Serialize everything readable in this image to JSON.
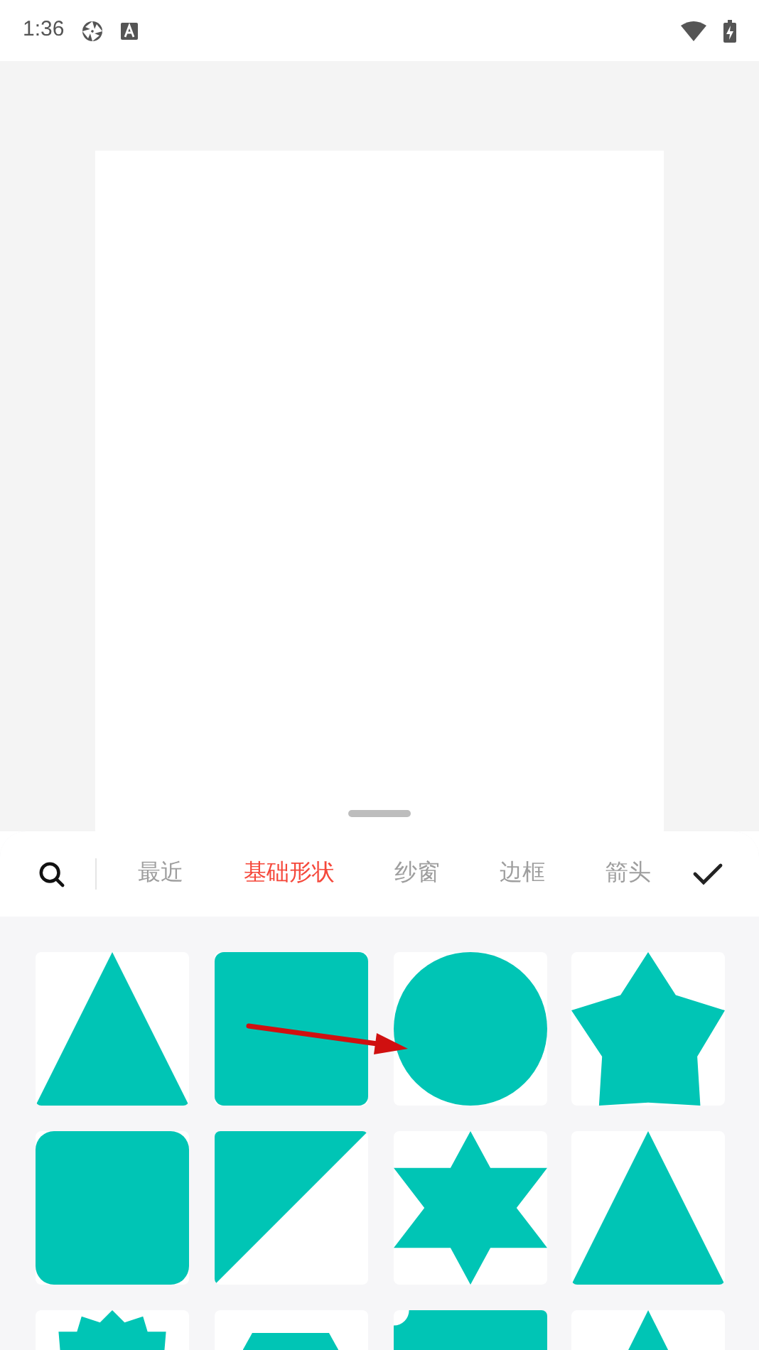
{
  "status_bar": {
    "time": "1:36"
  },
  "tabs": [
    {
      "label": "最近",
      "selected": false
    },
    {
      "label": "基础形状",
      "selected": true
    },
    {
      "label": "纱窗",
      "selected": false
    },
    {
      "label": "边框",
      "selected": false
    },
    {
      "label": "箭头",
      "selected": false
    }
  ],
  "shapes": [
    {
      "kind": "triangle"
    },
    {
      "kind": "square"
    },
    {
      "kind": "circle"
    },
    {
      "kind": "star"
    },
    {
      "kind": "rounded-square"
    },
    {
      "kind": "right-triangle"
    },
    {
      "kind": "hexagram"
    },
    {
      "kind": "tall-triangle"
    },
    {
      "kind": "starburst"
    },
    {
      "kind": "trapezoid"
    },
    {
      "kind": "snip-rect"
    },
    {
      "kind": "triangle"
    }
  ]
}
